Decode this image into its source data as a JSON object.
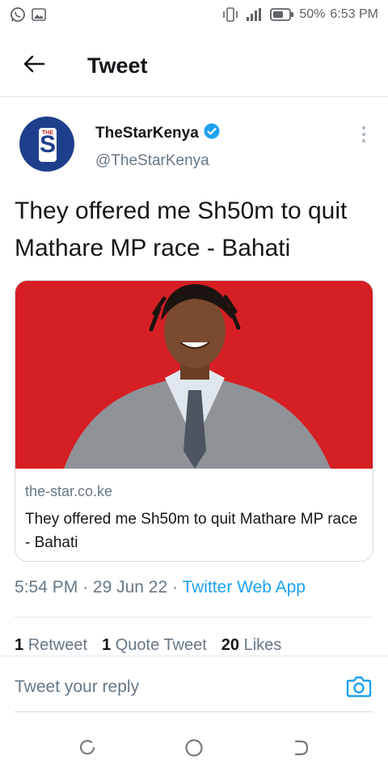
{
  "status_bar": {
    "left_icons": [
      "whatsapp-icon",
      "image-icon"
    ],
    "right_icons": [
      "vibrate-icon",
      "signal-icon",
      "battery-icon"
    ],
    "battery": "50%",
    "time": "6:53 PM"
  },
  "header": {
    "back_icon": "arrow-left-icon",
    "title": "Tweet"
  },
  "author": {
    "name": "TheStarKenya",
    "handle": "@TheStarKenya",
    "verified_icon": "verified-badge-icon",
    "avatar_letter": "S",
    "avatar_small_text": "THE"
  },
  "tweet": {
    "text": "They offered me Sh50m to quit Mathare MP race - Bahati"
  },
  "card": {
    "domain": "the-star.co.ke",
    "title": "They offered me Sh50m to quit Mathare MP race - Bahati",
    "image_bg": "#d61f24"
  },
  "meta": {
    "time": "5:54 PM",
    "sep1": "·",
    "date": "29 Jun 22",
    "sep2": "·",
    "app": "Twitter Web App"
  },
  "stats": {
    "retweets_count": "1",
    "retweets_label": "Retweet",
    "quotes_count": "1",
    "quotes_label": "Quote Tweet",
    "likes_count": "20",
    "likes_label": "Likes"
  },
  "reply": {
    "placeholder": "Tweet your reply",
    "camera_icon": "camera-icon"
  },
  "colors": {
    "accent": "#1da1f2",
    "avatar": "#1e3f8c",
    "card_image": "#d61f24"
  }
}
